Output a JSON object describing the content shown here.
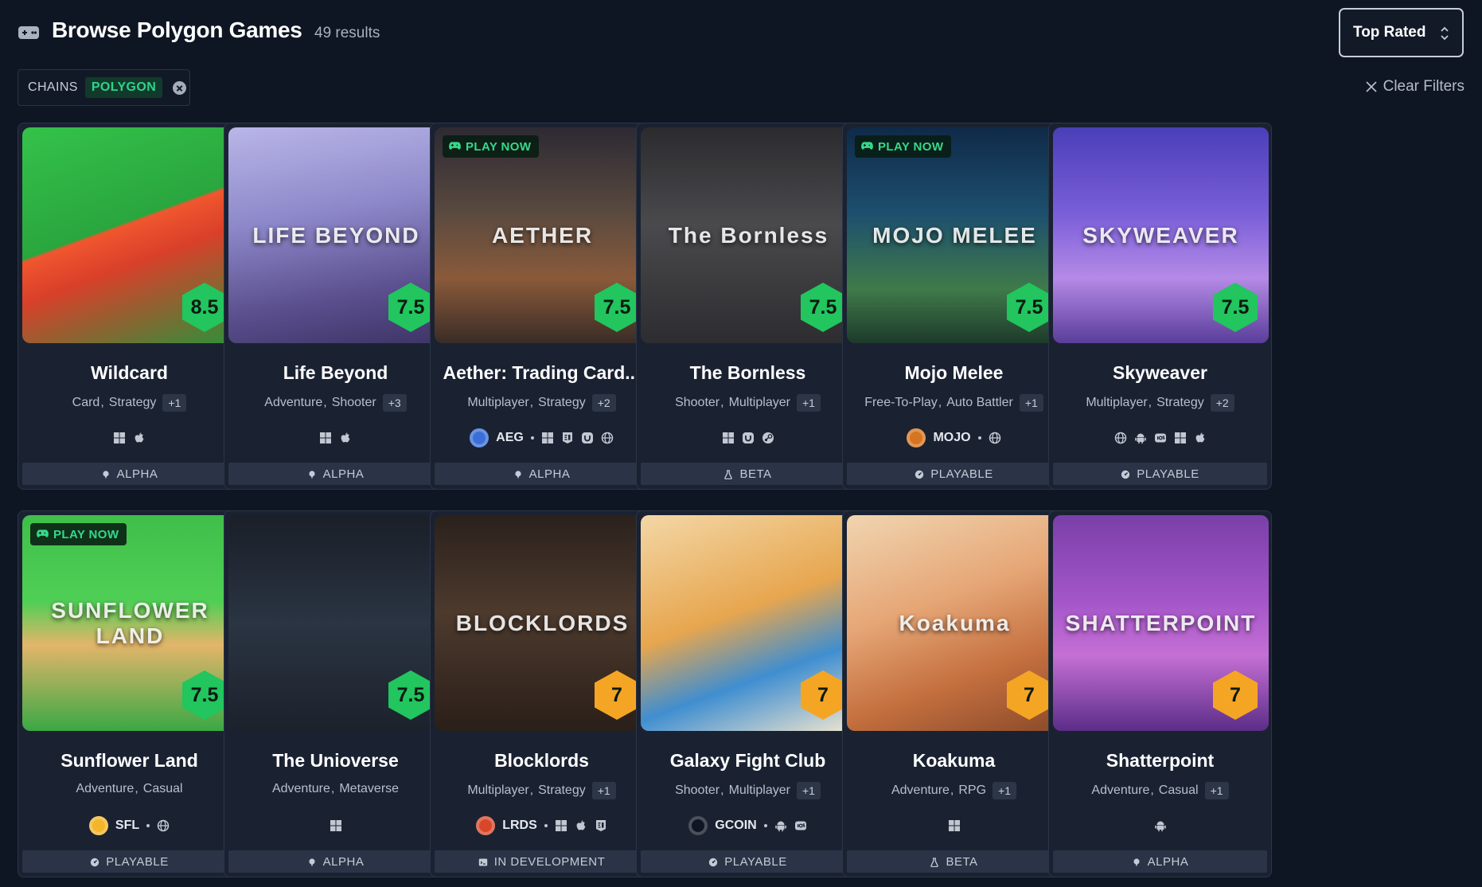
{
  "header": {
    "title": "Browse Polygon Games",
    "count": "49 results",
    "sort_label": "Top Rated"
  },
  "filters": {
    "chip_key": "CHAINS",
    "chip_value": "POLYGON",
    "clear_label": "Clear Filters"
  },
  "play_now_label": "PLAY NOW",
  "accent_colors": {
    "score_high": "#22c55e",
    "score_mid": "#f5a524",
    "play_now_text": "#34d98b"
  },
  "cards": [
    {
      "name": "Wildcard",
      "score": "8.5",
      "score_color": "green",
      "play_now": false,
      "art_text": "",
      "art_bg": "linear-gradient(160deg,#34c24a 0%,#2aa63e 45%,#f0562e 46%,#d9402a 60%,#2f8f3a 100%)",
      "genres": [
        "Card",
        "Strategy"
      ],
      "more": "+1",
      "token": null,
      "platforms": [
        "windows-icon",
        "apple-icon"
      ],
      "status": "ALPHA",
      "status_icon": "pin-icon"
    },
    {
      "name": "Life Beyond",
      "score": "7.5",
      "score_color": "green",
      "play_now": false,
      "art_text": "LIFE BEYOND",
      "art_bg": "linear-gradient(170deg,#b9b6e8 0%,#8d88c9 40%,#5b4f8e 75%,#3d3466 100%)",
      "genres": [
        "Adventure",
        "Shooter"
      ],
      "more": "+3",
      "token": null,
      "platforms": [
        "windows-icon",
        "apple-icon"
      ],
      "status": "ALPHA",
      "status_icon": "pin-icon"
    },
    {
      "name": "Aether: Trading Card...",
      "score": "7.5",
      "score_color": "green",
      "play_now": true,
      "art_text": "AETHER",
      "art_bg": "linear-gradient(180deg,#2d2a33 0%,#5a4a3f 40%,#8a5a3a 70%,#3a2c26 100%)",
      "genres": [
        "Multiplayer",
        "Strategy"
      ],
      "more": "+2",
      "token": {
        "symbol": "AEG",
        "logo_color": "#3b6fd8"
      },
      "platforms": [
        "windows-icon",
        "epic-icon",
        "ubisoft-icon",
        "web-icon"
      ],
      "status": "ALPHA",
      "status_icon": "pin-icon"
    },
    {
      "name": "The Bornless",
      "score": "7.5",
      "score_color": "green",
      "play_now": false,
      "art_text": "The Bornless",
      "art_bg": "linear-gradient(180deg,#2b2b2e 0%,#4a4a4d 45%,#2d2d30 100%)",
      "genres": [
        "Shooter",
        "Multiplayer"
      ],
      "more": "+1",
      "token": null,
      "platforms": [
        "windows-icon",
        "ubisoft-icon",
        "steam-icon"
      ],
      "status": "BETA",
      "status_icon": "flask-icon"
    },
    {
      "name": "Mojo Melee",
      "score": "7.5",
      "score_color": "green",
      "play_now": true,
      "art_text": "MOJO MELEE",
      "art_bg": "linear-gradient(180deg,#0f2a48 0%,#1d4f6e 40%,#3f7a4a 75%,#1d3a2a 100%)",
      "genres": [
        "Free-To-Play",
        "Auto Battler"
      ],
      "more": "+1",
      "token": {
        "symbol": "MOJO",
        "logo_color": "#d7741f"
      },
      "platforms": [
        "web-icon"
      ],
      "status": "PLAYABLE",
      "status_icon": "gauge-icon"
    },
    {
      "name": "Skyweaver",
      "score": "7.5",
      "score_color": "green",
      "play_now": false,
      "art_text": "SKYWEAVER",
      "art_bg": "linear-gradient(180deg,#4a3fb8 0%,#7a5ed9 40%,#b48ae6 70%,#5a3d9a 100%)",
      "genres": [
        "Multiplayer",
        "Strategy"
      ],
      "more": "+2",
      "token": null,
      "platforms": [
        "web-icon",
        "android-icon",
        "ios-icon",
        "windows-icon",
        "apple-icon"
      ],
      "status": "PLAYABLE",
      "status_icon": "gauge-icon"
    },
    {
      "name": "Sunflower Land",
      "score": "7.5",
      "score_color": "green",
      "play_now": true,
      "art_text": "SUNFLOWER LAND",
      "art_bg": "linear-gradient(180deg,#3fbf4a 0%,#4fcf55 40%,#e3b56a 60%,#3aa844 100%)",
      "genres": [
        "Adventure",
        "Casual"
      ],
      "more": "",
      "token": {
        "symbol": "SFL",
        "logo_color": "#f3b529"
      },
      "platforms": [
        "web-icon"
      ],
      "status": "PLAYABLE",
      "status_icon": "gauge-icon"
    },
    {
      "name": "The Unioverse",
      "score": "7.5",
      "score_color": "green",
      "play_now": false,
      "art_text": "",
      "art_bg": "linear-gradient(180deg,#1a1f28 0%,#2a3442 50%,#1c222c 100%)",
      "genres": [
        "Adventure",
        "Metaverse"
      ],
      "more": "",
      "token": null,
      "platforms": [
        "windows-icon"
      ],
      "status": "ALPHA",
      "status_icon": "pin-icon"
    },
    {
      "name": "Blocklords",
      "score": "7",
      "score_color": "orange",
      "play_now": false,
      "art_text": "BLOCKLORDS",
      "art_bg": "linear-gradient(180deg,#2a211c 0%,#4d3a2d 45%,#2a1f19 100%)",
      "genres": [
        "Multiplayer",
        "Strategy"
      ],
      "more": "+1",
      "token": {
        "symbol": "LRDS",
        "logo_color": "#d9472b"
      },
      "platforms": [
        "windows-icon",
        "apple-icon",
        "epic-icon"
      ],
      "status": "IN DEVELOPMENT",
      "status_icon": "dev-icon"
    },
    {
      "name": "Galaxy Fight Club",
      "score": "7",
      "score_color": "orange",
      "play_now": false,
      "art_text": "",
      "art_bg": "linear-gradient(160deg,#f3d7a6 0%,#e7a64f 45%,#3f8ed0 70%,#f1e6cf 100%)",
      "genres": [
        "Shooter",
        "Multiplayer"
      ],
      "more": "+1",
      "token": {
        "symbol": "GCOIN",
        "logo_color": "#0f1623"
      },
      "platforms": [
        "android-icon",
        "ios-icon"
      ],
      "status": "PLAYABLE",
      "status_icon": "gauge-icon"
    },
    {
      "name": "Koakuma",
      "score": "7",
      "score_color": "orange",
      "play_now": false,
      "art_text": "Koakuma",
      "art_bg": "linear-gradient(160deg,#f0d5b0 0%,#e6a676 40%,#c5703f 70%,#8a4a2a 100%)",
      "genres": [
        "Adventure",
        "RPG"
      ],
      "more": "+1",
      "token": null,
      "platforms": [
        "windows-icon"
      ],
      "status": "BETA",
      "status_icon": "flask-icon"
    },
    {
      "name": "Shatterpoint",
      "score": "7",
      "score_color": "orange",
      "play_now": false,
      "art_text": "SHATTERPOINT",
      "art_bg": "linear-gradient(180deg,#7a3fa8 0%,#a456c9 40%,#c56fd4 65%,#5b2d88 100%)",
      "genres": [
        "Adventure",
        "Casual"
      ],
      "more": "+1",
      "token": null,
      "platforms": [
        "android-icon"
      ],
      "status": "ALPHA",
      "status_icon": "pin-icon"
    }
  ]
}
